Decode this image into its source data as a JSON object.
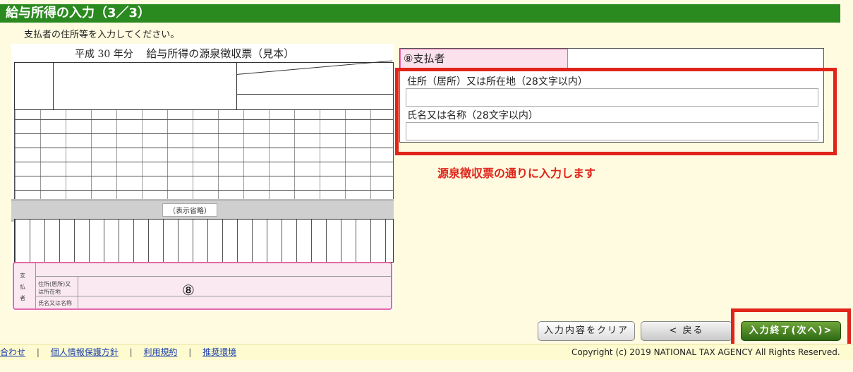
{
  "header": {
    "title": "給与所得の入力（3／3）"
  },
  "subtitle": "支払者の住所等を入力してください。",
  "sample": {
    "year_prefix": "平成",
    "year_num": "30",
    "year_suffix": "年分",
    "form_title": "給与所得の源泉徴収票（見本）",
    "omitted_label": "（表示省略）",
    "circle_num": "⑧",
    "payer_side": "支払者",
    "payer_addr": "住所(居所)又は所在地",
    "payer_name": "氏名又は名称"
  },
  "panel": {
    "section_title": "⑧支払者",
    "address_label": "住所（居所）又は所在地（28文字以内）",
    "address_value": "",
    "name_label": "氏名又は名称（28文字以内）",
    "name_value": ""
  },
  "note": "源泉徴収票の通りに入力します",
  "buttons": {
    "clear": "入力内容をクリア",
    "back": "< 戻る",
    "next": "入力終了(次へ)>"
  },
  "footer": {
    "links": [
      "合わせ",
      "個人情報保護方針",
      "利用規約",
      "推奨環境"
    ],
    "copyright": "Copyright (c) 2019 NATIONAL TAX AGENCY All Rights Reserved."
  }
}
